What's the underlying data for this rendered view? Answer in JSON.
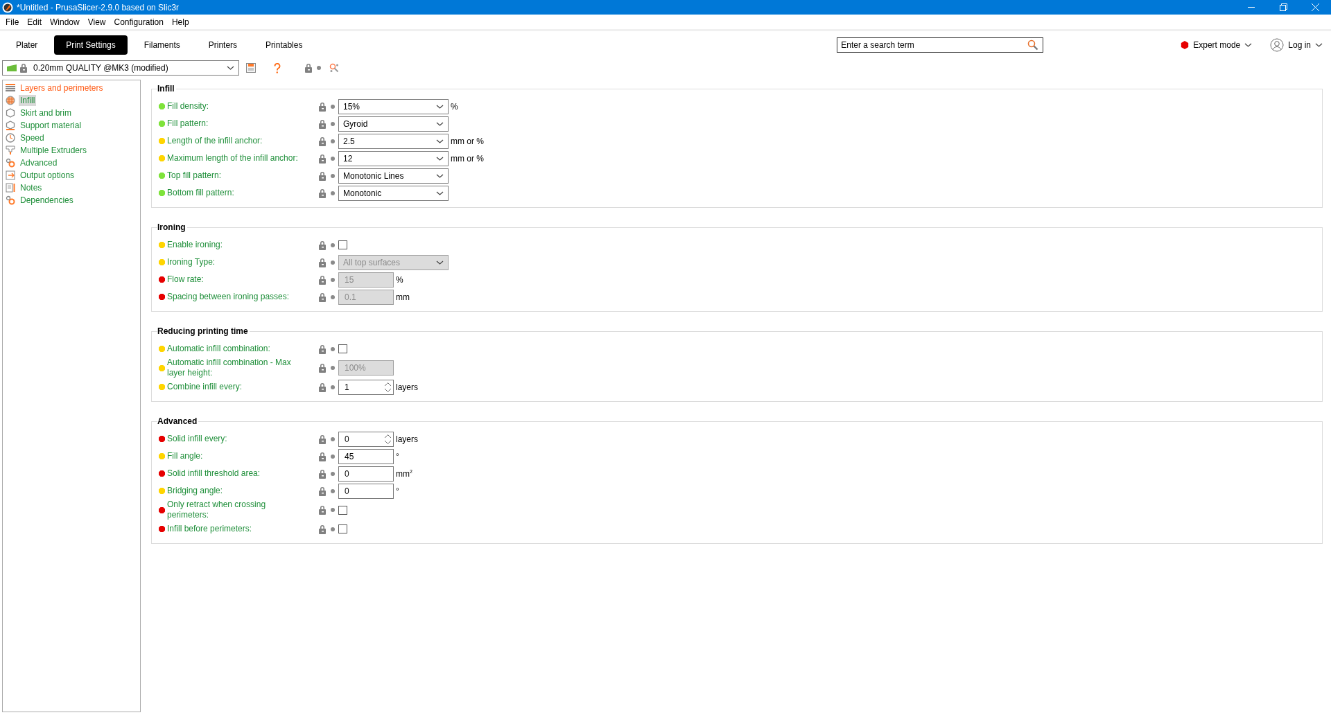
{
  "window": {
    "title": "*Untitled - PrusaSlicer-2.9.0 based on Slic3r"
  },
  "menu": [
    "File",
    "Edit",
    "Window",
    "View",
    "Configuration",
    "Help"
  ],
  "tabs": [
    {
      "label": "Plater",
      "selected": false
    },
    {
      "label": "Print Settings",
      "selected": true
    },
    {
      "label": "Filaments",
      "selected": false
    },
    {
      "label": "Printers",
      "selected": false
    },
    {
      "label": "Printables",
      "selected": false
    }
  ],
  "search": {
    "placeholder": "Enter a search term"
  },
  "mode": {
    "label": "Expert mode"
  },
  "login": {
    "label": "Log in"
  },
  "preset": {
    "value": "0.20mm QUALITY @MK3 (modified)"
  },
  "sidebar": {
    "items": [
      {
        "label": "Layers and perimeters",
        "selected": false,
        "color": "#ff5a14"
      },
      {
        "label": "Infill",
        "selected": true,
        "color": "#1f8f3a"
      },
      {
        "label": "Skirt and brim",
        "selected": false,
        "color": "#1f8f3a"
      },
      {
        "label": "Support material",
        "selected": false,
        "color": "#1f8f3a"
      },
      {
        "label": "Speed",
        "selected": false,
        "color": "#1f8f3a"
      },
      {
        "label": "Multiple Extruders",
        "selected": false,
        "color": "#1f8f3a"
      },
      {
        "label": "Advanced",
        "selected": false,
        "color": "#1f8f3a"
      },
      {
        "label": "Output options",
        "selected": false,
        "color": "#1f8f3a"
      },
      {
        "label": "Notes",
        "selected": false,
        "color": "#1f8f3a"
      },
      {
        "label": "Dependencies",
        "selected": false,
        "color": "#1f8f3a"
      }
    ]
  },
  "groups": [
    {
      "title": "Infill",
      "rows": [
        {
          "label": "Fill density:",
          "color": "#7ee33a",
          "kind": "combo",
          "value": "15%",
          "disabled": false,
          "unit": "%"
        },
        {
          "label": "Fill pattern:",
          "color": "#7ee33a",
          "kind": "combo",
          "value": "Gyroid",
          "disabled": false
        },
        {
          "label": "Length of the infill anchor:",
          "color": "#ffd500",
          "kind": "combo",
          "value": "2.5",
          "disabled": false,
          "unit": "mm or %"
        },
        {
          "label": "Maximum length of the infill anchor:",
          "color": "#ffd500",
          "kind": "combo",
          "value": "12",
          "disabled": false,
          "unit": "mm or %"
        },
        {
          "label": "Top fill pattern:",
          "color": "#7ee33a",
          "kind": "combo",
          "value": "Monotonic Lines",
          "disabled": false
        },
        {
          "label": "Bottom fill pattern:",
          "color": "#7ee33a",
          "kind": "combo",
          "value": "Monotonic",
          "disabled": false
        }
      ]
    },
    {
      "title": "Ironing",
      "rows": [
        {
          "label": "Enable ironing:",
          "color": "#ffd500",
          "kind": "checkbox",
          "checked": false
        },
        {
          "label": "Ironing Type:",
          "color": "#ffd500",
          "kind": "combo",
          "value": "All top surfaces",
          "disabled": true
        },
        {
          "label": "Flow rate:",
          "color": "#e60000",
          "kind": "text",
          "value": "15",
          "disabled": true,
          "unit": "%"
        },
        {
          "label": "Spacing between ironing passes:",
          "color": "#e60000",
          "kind": "text",
          "value": "0.1",
          "disabled": true,
          "unit": "mm"
        }
      ]
    },
    {
      "title": "Reducing printing time",
      "rows": [
        {
          "label": "Automatic infill combination:",
          "color": "#ffd500",
          "kind": "checkbox",
          "checked": false
        },
        {
          "label": "Automatic infill combination - Max layer height:",
          "color": "#ffd500",
          "kind": "text",
          "value": "100%",
          "disabled": true
        },
        {
          "label": "Combine infill every:",
          "color": "#ffd500",
          "kind": "spin",
          "value": "1",
          "disabled": false,
          "unit": "layers"
        }
      ]
    },
    {
      "title": "Advanced",
      "rows": [
        {
          "label": "Solid infill every:",
          "color": "#e60000",
          "kind": "spin",
          "value": "0",
          "disabled": false,
          "unit": "layers"
        },
        {
          "label": "Fill angle:",
          "color": "#ffd500",
          "kind": "text",
          "value": "45",
          "disabled": false,
          "unit": "°"
        },
        {
          "label": "Solid infill threshold area:",
          "color": "#e60000",
          "kind": "text",
          "value": "0",
          "disabled": false,
          "unit": "mm$^{2}$"
        },
        {
          "label": "Bridging angle:",
          "color": "#ffd500",
          "kind": "text",
          "value": "0",
          "disabled": false,
          "unit": "°"
        },
        {
          "label": "Only retract when crossing perimeters:",
          "color": "#e60000",
          "kind": "checkbox",
          "checked": false
        },
        {
          "label": "Infill before perimeters:",
          "color": "#e60000",
          "kind": "checkbox",
          "checked": false
        }
      ]
    }
  ]
}
